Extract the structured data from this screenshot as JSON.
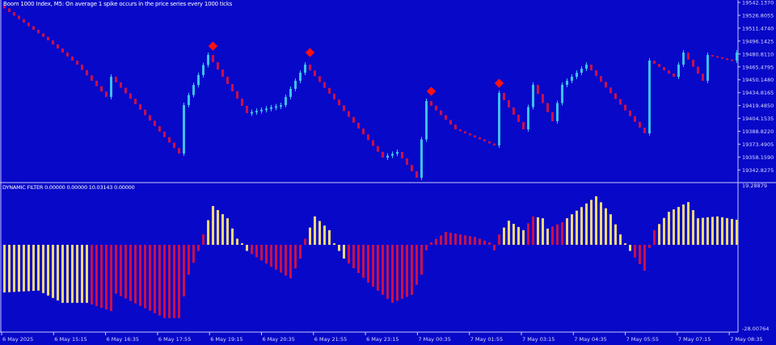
{
  "header": {
    "title": "Boom 1000 Index, M5:  On average 1 spike occurs in the price series every 1000 ticks"
  },
  "indicator": {
    "label": "DYNAMIC FILTER 0.00000 0.00000 10.03143 0.00000",
    "max_label": "19.28879",
    "min_label": "-28.00764"
  },
  "price_axis": [
    "19542.1370",
    "19526.8055",
    "19511.4740",
    "19496.1425",
    "19480.8110",
    "19465.4795",
    "19450.1480",
    "19434.8165",
    "19419.4850",
    "19404.1535",
    "19388.8220",
    "19373.4905",
    "19358.1590",
    "19342.8275"
  ],
  "time_axis": [
    "6 May 2025",
    "6 May 15:15",
    "6 May 16:35",
    "6 May 17:55",
    "6 May 19:15",
    "6 May 20:35",
    "6 May 21:55",
    "6 May 23:15",
    "7 May 00:35",
    "7 May 01:55",
    "7 May 03:15",
    "7 May 04:35",
    "7 May 05:55",
    "7 May 07:15",
    "7 May 08:35"
  ],
  "colors": {
    "background": "#0808c8",
    "up": "#3cc0ee",
    "down": "#c8104a",
    "signal": "#ff1010",
    "hist_up": "#f0d878",
    "hist_down": "#c8104a",
    "axis": "#c8c8ff"
  },
  "chart_data": [
    {
      "type": "candlestick",
      "title": "Boom 1000 Index, M5",
      "bars": 152,
      "ylim": [
        19330,
        19542.137
      ],
      "close_waypoints": [
        [
          0,
          19535
        ],
        [
          1,
          19530.6
        ],
        [
          9,
          19496.9
        ],
        [
          15,
          19468.0
        ],
        [
          21,
          19429.5
        ],
        [
          22,
          19453.5
        ],
        [
          36,
          19362.0
        ],
        [
          37,
          19419.8
        ],
        [
          42,
          19479.5
        ],
        [
          50,
          19410.2
        ],
        [
          57,
          19419.8
        ],
        [
          62,
          19468.0
        ],
        [
          78,
          19357.2
        ],
        [
          81,
          19364.0
        ],
        [
          85,
          19333.2
        ],
        [
          87,
          19424.6
        ],
        [
          93,
          19390.9
        ],
        [
          101,
          19371.7
        ],
        [
          102,
          19434.3
        ],
        [
          107,
          19390.9
        ],
        [
          109,
          19443.9
        ],
        [
          113,
          19400.6
        ],
        [
          115,
          19443.9
        ],
        [
          120,
          19468.0
        ],
        [
          132,
          19386.1
        ],
        [
          133,
          19472.8
        ],
        [
          138,
          19453.5
        ],
        [
          140,
          19482.4
        ],
        [
          144,
          19448.7
        ],
        [
          145,
          19479.5
        ],
        [
          150,
          19472.8
        ],
        [
          151,
          19482.4
        ]
      ],
      "signals": [
        [
          43,
          19490.1
        ],
        [
          63,
          19482.4
        ],
        [
          88,
          19436.2
        ],
        [
          102,
          19445.8
        ]
      ]
    },
    {
      "type": "bar",
      "title": "DYNAMIC FILTER",
      "ylim": [
        -28.00764,
        19.28879
      ],
      "waypoints": [
        [
          0,
          -15.6,
          "up"
        ],
        [
          7,
          -15,
          "up"
        ],
        [
          12,
          -19,
          "up"
        ],
        [
          17,
          -19,
          "down"
        ],
        [
          22,
          -21.7,
          "down"
        ],
        [
          23,
          -16,
          "down"
        ],
        [
          28,
          -20,
          "down"
        ],
        [
          33,
          -24,
          "down"
        ],
        [
          36,
          -24,
          "down"
        ],
        [
          38,
          -9.8,
          "down"
        ],
        [
          40,
          -2,
          "down"
        ],
        [
          41,
          3.4,
          "up"
        ],
        [
          43,
          12.7,
          "up"
        ],
        [
          46,
          8.7,
          "up"
        ],
        [
          48,
          2,
          "up"
        ],
        [
          49,
          0.5,
          "up"
        ],
        [
          50,
          -2,
          "down"
        ],
        [
          55,
          -7.2,
          "down"
        ],
        [
          59,
          -11,
          "down"
        ],
        [
          61,
          -4.5,
          "down"
        ],
        [
          62,
          2,
          "up"
        ],
        [
          64,
          9.3,
          "up"
        ],
        [
          67,
          4.8,
          "up"
        ],
        [
          68,
          0.5,
          "up"
        ],
        [
          70,
          -4.5,
          "down"
        ],
        [
          75,
          -12.4,
          "down"
        ],
        [
          80,
          -19,
          "down"
        ],
        [
          84,
          -16.4,
          "down"
        ],
        [
          86,
          -9.8,
          "down"
        ],
        [
          87,
          -1.8,
          "down"
        ],
        [
          88,
          0.8,
          "down"
        ],
        [
          91,
          4.2,
          "down"
        ],
        [
          97,
          2.6,
          "down"
        ],
        [
          100,
          0.8,
          "down"
        ],
        [
          101,
          -1.8,
          "down"
        ],
        [
          102,
          3.4,
          "up"
        ],
        [
          104,
          7.9,
          "up"
        ],
        [
          107,
          4.8,
          "down"
        ],
        [
          109,
          9.3,
          "up"
        ],
        [
          111,
          8.7,
          "up"
        ],
        [
          112,
          5.3,
          "down"
        ],
        [
          115,
          7.4,
          "up"
        ],
        [
          117,
          10,
          "up"
        ],
        [
          122,
          15.9,
          "up"
        ],
        [
          125,
          10,
          "up"
        ],
        [
          127,
          3.4,
          "up"
        ],
        [
          128,
          0.5,
          "up"
        ],
        [
          129,
          -2,
          "down"
        ],
        [
          132,
          -8.5,
          "down"
        ],
        [
          133,
          -1,
          "down"
        ],
        [
          134,
          4.8,
          "up"
        ],
        [
          137,
          10.8,
          "up"
        ],
        [
          141,
          14,
          "up"
        ],
        [
          143,
          8.7,
          "up"
        ],
        [
          147,
          9.3,
          "up"
        ],
        [
          151,
          8.2,
          "up"
        ]
      ]
    }
  ]
}
